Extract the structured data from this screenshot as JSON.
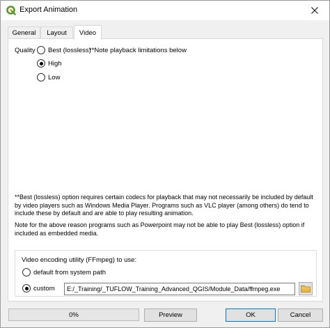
{
  "window": {
    "title": "Export Animation"
  },
  "icons": {
    "app": "qgis-logo-icon",
    "close": "close-icon",
    "folder": "folder-icon"
  },
  "tabs": [
    {
      "label": "General",
      "active": false
    },
    {
      "label": "Layout",
      "active": false
    },
    {
      "label": "Video",
      "active": true
    }
  ],
  "quality": {
    "label": "Quality",
    "note": "**Note playback limitations below",
    "options": [
      {
        "label": "Best (lossless)",
        "checked": false
      },
      {
        "label": "High",
        "checked": true
      },
      {
        "label": "Low",
        "checked": false
      }
    ]
  },
  "notes": {
    "lossless": "**Best (lossless) option requires certain codecs for playback that may not necessarily be included by default by video players such as Windows Media Player. Programs such as VLC player (among others) do tend to include these by default and are able to play resulting animation.",
    "powerpoint": "Note for the above reason programs such as Powerpoint may not be able to play Best (lossless) option if included as embedded media."
  },
  "ffmpeg": {
    "group_label": "Video encoding utility (FFmpeg) to use:",
    "default_option": {
      "label": "default from system path",
      "checked": false
    },
    "custom_option": {
      "label": "custom",
      "checked": true
    },
    "path_value": "E:/_Training/_TUFLOW_Training_Advanced_QGIS/Module_Data/ffmpeg.exe"
  },
  "footer": {
    "progress_text": "0%",
    "progress_value": 0,
    "preview_label": "Preview",
    "ok_label": "OK",
    "cancel_label": "Cancel"
  },
  "colors": {
    "accent": "#0078d7",
    "folder": "#e8b84a",
    "logo": "#589632"
  }
}
